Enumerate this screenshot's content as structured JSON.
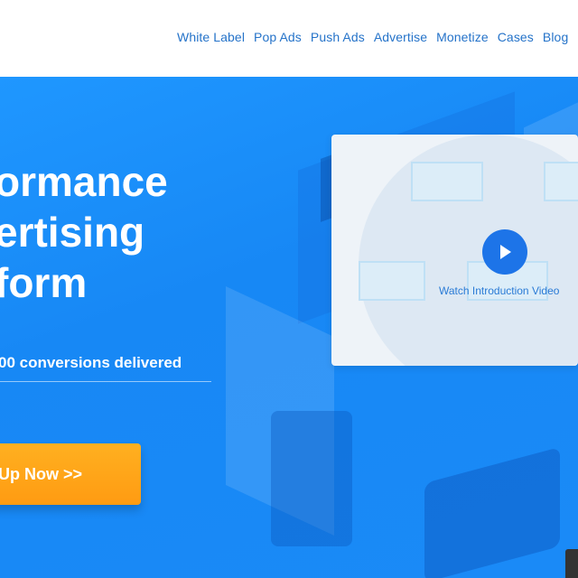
{
  "nav": {
    "items": [
      "White Label",
      "Pop Ads",
      "Push Ads",
      "Advertise",
      "Monetize",
      "Cases",
      "Blog"
    ]
  },
  "hero": {
    "headline_line1": "ormance",
    "headline_line2": "ertising",
    "headline_line3": "form",
    "subtitle": "00 conversions delivered",
    "cta_label": "Up Now >>"
  },
  "video": {
    "watch_label": "Watch Introduction Video"
  },
  "colors": {
    "hero_bg": "#1a8af7",
    "nav_link": "#2573c9",
    "cta": "#ffa51a",
    "play": "#1d74e8"
  },
  "icons": [
    "play-icon"
  ]
}
